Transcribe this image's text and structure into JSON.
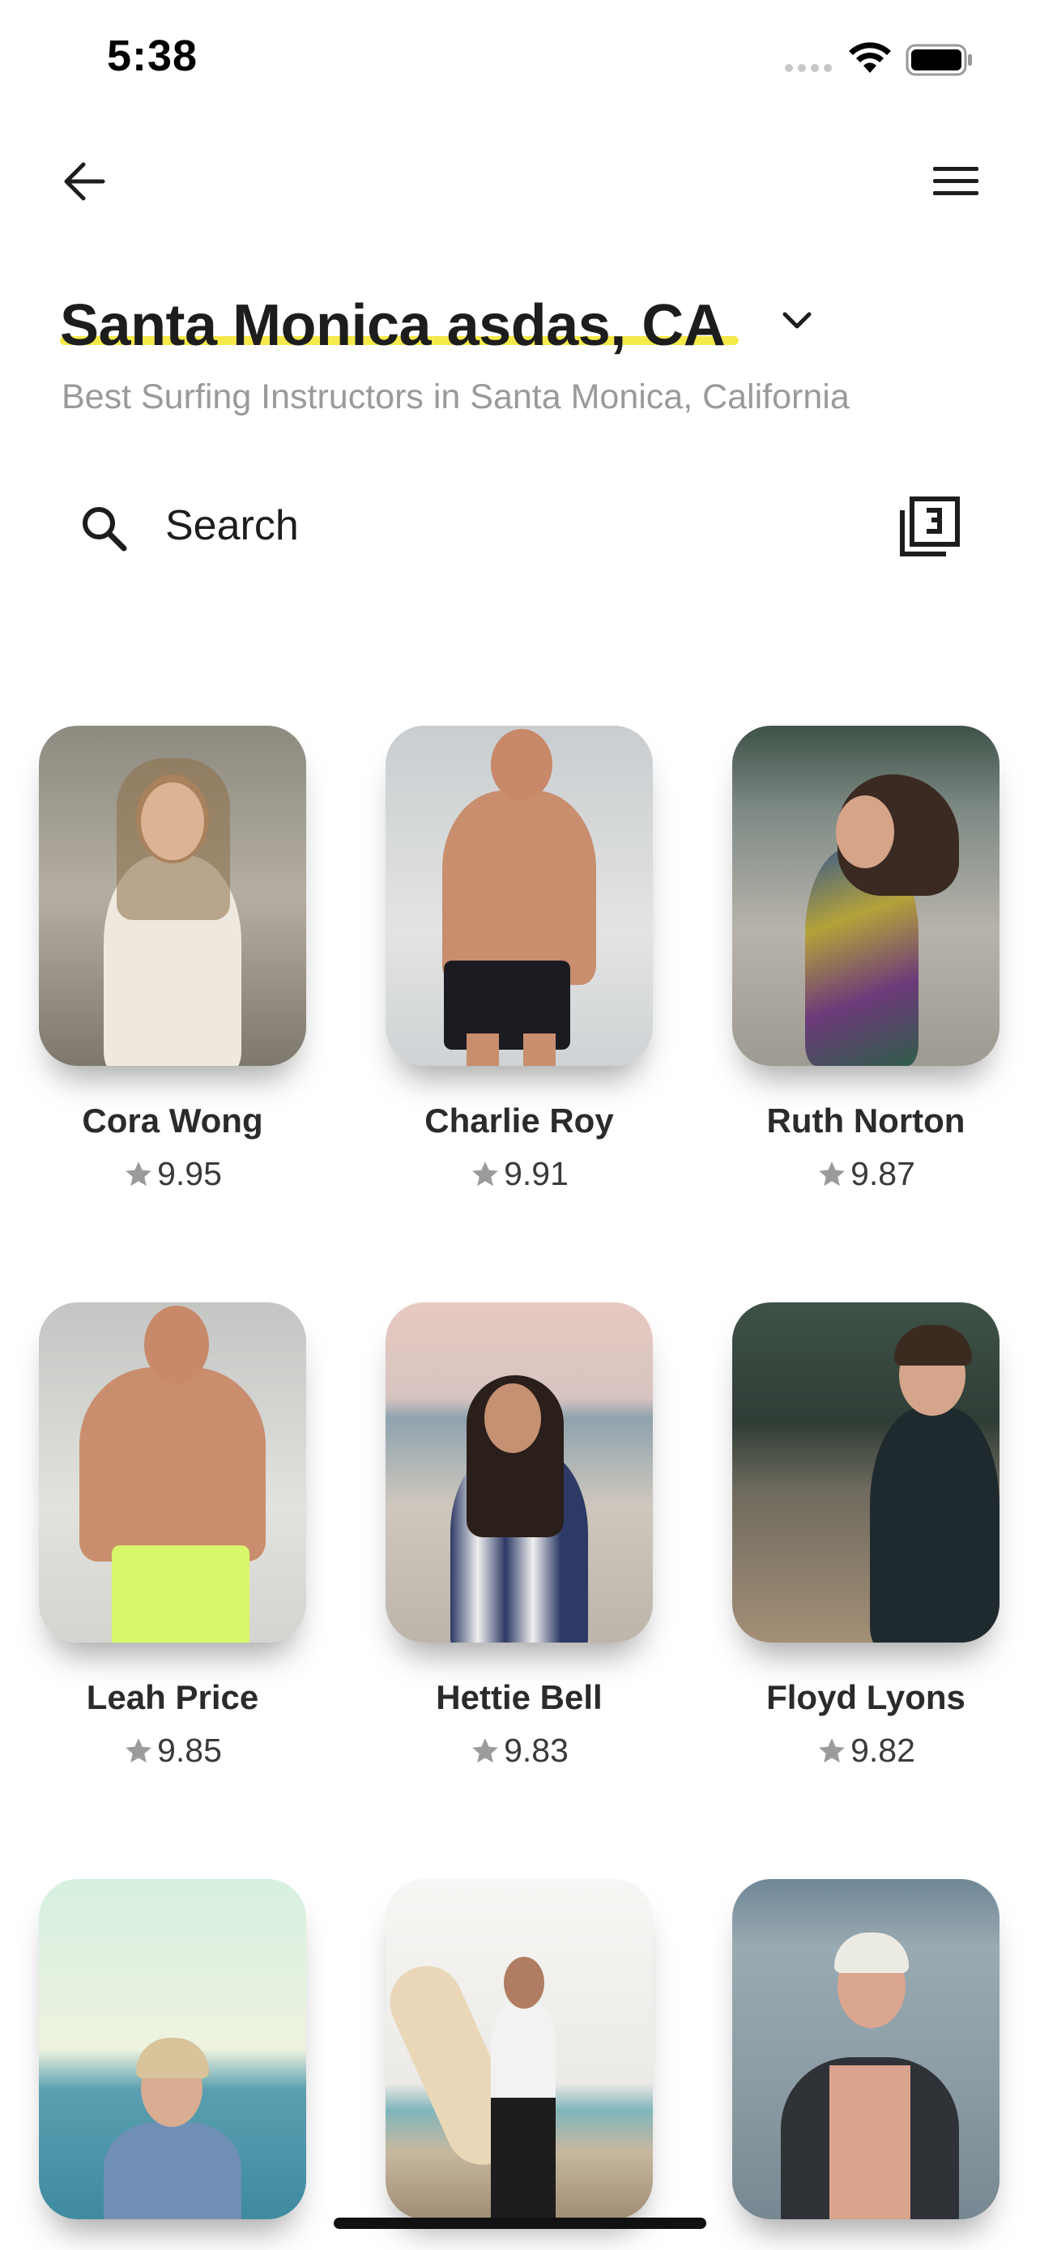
{
  "status_bar": {
    "time": "5:38"
  },
  "header": {
    "back_icon": "arrow-left-icon",
    "menu_icon": "hamburger-icon",
    "title": "Santa Monica asdas, CA",
    "title_highlight_color": "#f6e94a",
    "subtitle": "Best Surfing Instructors in Santa Monica, California"
  },
  "search": {
    "placeholder": "Search",
    "icon": "search-icon",
    "filter_icon": "filter-list-icon"
  },
  "instructors": [
    {
      "name": "Cora Wong",
      "rating": "9.95"
    },
    {
      "name": "Charlie Roy",
      "rating": "9.91"
    },
    {
      "name": "Ruth Norton",
      "rating": "9.87"
    },
    {
      "name": "Leah Price",
      "rating": "9.85"
    },
    {
      "name": "Hettie Bell",
      "rating": "9.83"
    },
    {
      "name": "Floyd Lyons",
      "rating": "9.82"
    },
    {
      "name": "",
      "rating": ""
    },
    {
      "name": "",
      "rating": ""
    },
    {
      "name": "",
      "rating": ""
    }
  ],
  "colors": {
    "star": "#9b9b9b",
    "text": "#2b2b2b",
    "subtitle": "#9a9a9a"
  }
}
